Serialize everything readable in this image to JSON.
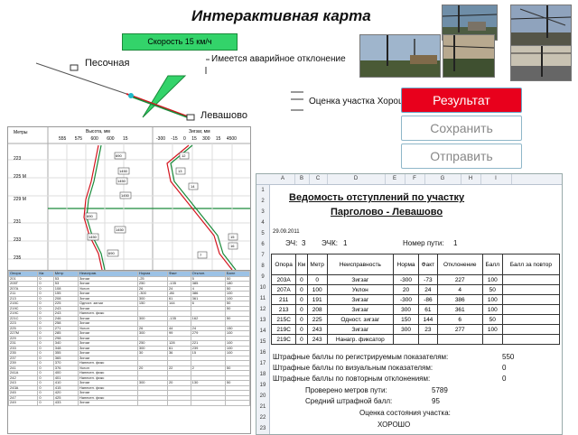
{
  "title": "Интерактивная карта",
  "map": {
    "speed_label": "Скорость 15 км/ч",
    "station_start": "Песочная",
    "station_end": "Левашово",
    "note_deviation": "Имеется аварийное отклонение",
    "note_rating": "Оценка участка Хороше"
  },
  "actions": {
    "result_label": "Результат",
    "save_label": "Сохранить",
    "send_label": "Отправить"
  },
  "chart": {
    "left_header": "Метры",
    "mid_header": "Высота, мм",
    "right_header": "Зигзаг, мм",
    "mid_ticks": [
      "555",
      "575",
      "600",
      "600",
      "15"
    ],
    "right_ticks": [
      "-300",
      "-15",
      "0",
      "15",
      "300",
      "15",
      "4500"
    ],
    "row_labels": [
      "223",
      "225 М",
      "229 М",
      "231",
      "233",
      "235"
    ],
    "left_callouts": [
      "690",
      "1450",
      "1450",
      "1450",
      "690",
      "1450",
      "1450",
      "690"
    ],
    "right_callouts": [
      "12",
      "13",
      "14",
      "15",
      "16",
      "7"
    ]
  },
  "raw_table": {
    "headers": [
      "Опора",
      "Км",
      "Метр",
      "Неисправ.",
      "Норма",
      "Факт",
      "Отклон.",
      "Балл"
    ],
    "rows": [
      [
        "201",
        "0",
        "53",
        "Зигзаг",
        "-25",
        "",
        "5",
        "50"
      ],
      [
        "205Т",
        "0",
        "53",
        "Зигзаг",
        "250",
        "-135",
        "385",
        "180"
      ],
      [
        "207А",
        "0",
        "108",
        "Уклон",
        "26",
        "24",
        "4",
        "50"
      ],
      [
        "211",
        "0",
        "155",
        "Зигзаг",
        "-300",
        "-86",
        "386",
        "100"
      ],
      [
        "213",
        "0",
        "208",
        "Зигзаг",
        "300",
        "61",
        "361",
        "100"
      ],
      [
        "215С",
        "0",
        "225",
        "Одност. зигзаг",
        "150",
        "144",
        "6",
        "50"
      ],
      [
        "219С",
        "0",
        "243",
        "Зигзаг",
        "",
        "",
        "",
        "50"
      ],
      [
        "219С",
        "0",
        "243",
        "Нанесен. фикс",
        "",
        "",
        "",
        ""
      ],
      [
        "221С",
        "0",
        "246",
        "Зигзаг",
        "300",
        "-135",
        "162",
        "50"
      ],
      [
        "223",
        "0",
        "258",
        "Зигзаг",
        "",
        "",
        "",
        ""
      ],
      [
        "225",
        "0",
        "271",
        "Уклон",
        "26",
        "44",
        "24",
        "150"
      ],
      [
        "227М",
        "0",
        "285",
        "Зигзаг",
        "300",
        "99",
        "279",
        "100"
      ],
      [
        "229",
        "0",
        "298",
        "Зигзаг",
        "",
        "",
        "",
        ""
      ],
      [
        "231",
        "0",
        "340",
        "Зигзаг",
        "250",
        "128",
        "221",
        "100"
      ],
      [
        "233",
        "0",
        "348",
        "Зигзаг",
        "300",
        "61",
        "239",
        "100"
      ],
      [
        "235",
        "0",
        "355",
        "Зигзаг",
        "30",
        "36",
        "15",
        "100"
      ],
      [
        "237",
        "0",
        "365",
        "Зигзаг",
        "",
        "",
        "",
        ""
      ],
      [
        "239",
        "0",
        "370",
        "Нанесен. фикс",
        "",
        "",
        "",
        ""
      ],
      [
        "241",
        "0",
        "376",
        "Уклон",
        "20",
        "22",
        "2",
        "50"
      ],
      [
        "241А",
        "0",
        "400",
        "Нанесен. фикс",
        "",
        "",
        "",
        ""
      ],
      [
        "242",
        "0",
        "401",
        "Нанесен. фикс",
        "",
        "",
        "",
        ""
      ],
      [
        "243",
        "0",
        "410",
        "Зигзаг",
        "300",
        "20",
        "130",
        "50"
      ],
      [
        "243А",
        "0",
        "415",
        "Нанесен. фикс",
        "",
        "",
        "",
        ""
      ],
      [
        "245",
        "0",
        "420",
        "Зигзаг",
        "",
        "",
        "",
        ""
      ],
      [
        "247",
        "0",
        "425",
        "Нанесен. фикс",
        "",
        "",
        "",
        ""
      ],
      [
        "249",
        "0",
        "433",
        "Зигзаг",
        "",
        "",
        "",
        ""
      ]
    ]
  },
  "sheet": {
    "columns": [
      "A",
      "B",
      "C",
      "D",
      "E",
      "F",
      "G",
      "H",
      "I"
    ],
    "row_numbers": [
      "1",
      "2",
      "3",
      "4",
      "5",
      "6",
      "7",
      "8",
      "9",
      "10",
      "11",
      "12",
      "13",
      "14",
      "15",
      "16",
      "17",
      "18",
      "19",
      "20",
      "21",
      "22",
      "23"
    ],
    "heading_line1": "Ведомость отступлений по участку",
    "heading_line2": "Парголово - Левашово",
    "date": "29.09.2011",
    "ech_label": "ЭЧ:",
    "ech_value": "3",
    "echk_label": "ЭЧК:",
    "echk_value": "1",
    "track_label": "Номер пути:",
    "track_value": "1",
    "table_headers": [
      "Опора",
      "Км",
      "Метр",
      "Неисправность",
      "Норма",
      "Факт",
      "Отклонение",
      "Балл",
      "Балл за повтор"
    ],
    "table_rows": [
      [
        "203А",
        "0",
        "0",
        "Зигзаг",
        "-300",
        "-73",
        "227",
        "100",
        ""
      ],
      [
        "207А",
        "0",
        "100",
        "Уклон",
        "20",
        "24",
        "4",
        "50",
        ""
      ],
      [
        "211",
        "0",
        "191",
        "Зигзаг",
        "-300",
        "-86",
        "386",
        "100",
        ""
      ],
      [
        "213",
        "0",
        "208",
        "Зигзаг",
        "300",
        "61",
        "361",
        "100",
        ""
      ],
      [
        "215С",
        "0",
        "225",
        "Одност. зигзаг",
        "150",
        "144",
        "6",
        "50",
        ""
      ],
      [
        "219С",
        "0",
        "243",
        "Зигзаг",
        "300",
        "23",
        "277",
        "100",
        ""
      ],
      [
        "219С",
        "0",
        "243",
        "Нанагр. фиксатор",
        "",
        "",
        "",
        "",
        ""
      ]
    ],
    "penalty_registered_label": "Штрафные баллы по регистрируемым показателям:",
    "penalty_registered_value": "550",
    "penalty_visual_label": "Штрафные баллы по визуальным показателям:",
    "penalty_visual_value": "0",
    "penalty_repeat_label": "Штрафные баллы по повторным отклонениям:",
    "penalty_repeat_value": "0",
    "checked_meters_label": "Проверено метров пути:",
    "checked_meters_value": "5789",
    "avg_penalty_label": "Средний штрафной балл:",
    "avg_penalty_value": "95",
    "assessment_label": "Оценка состояния участка:",
    "assessment_value": "ХОРОШО"
  },
  "colors": {
    "accent_red": "#e8001c",
    "speed_green": "#33d36a",
    "table_header_blue": "#9cc2e5",
    "route_red": "#d4141e",
    "route_green": "#1a8a3a"
  }
}
